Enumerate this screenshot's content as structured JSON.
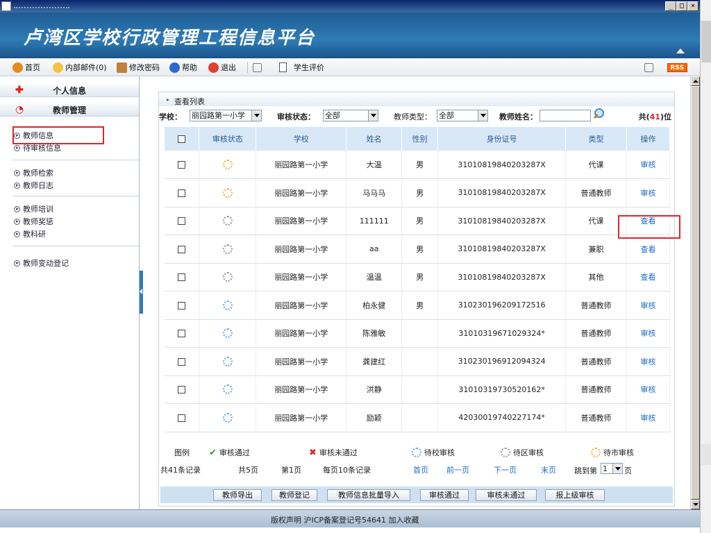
{
  "window": {
    "min_glyph": "_",
    "max_glyph": "□",
    "close_glyph": "×"
  },
  "header": {
    "title": "卢湾区学校行政管理工程信息平台"
  },
  "toolbar": {
    "home": "首页",
    "mail": "内部邮件(0)",
    "change_pwd": "修改密码",
    "help": "帮助",
    "logout": "退出",
    "student_eval": "学生评价",
    "rss": "RSS",
    "colors": {
      "home": "#e48c1e",
      "mail": "#f3c443",
      "pwd": "#c08040",
      "help": "#2a6ad0",
      "logout": "#e04030"
    }
  },
  "sidebar": {
    "sections": [
      {
        "label": "个人信息",
        "icon": "personal-icon"
      },
      {
        "label": "教师管理",
        "icon": "teacher-manage-icon"
      }
    ],
    "groups": [
      [
        "教师信息",
        "待审核信息"
      ],
      [
        "教师检索",
        "教师日志"
      ],
      [
        "教师培训",
        "教师奖惩",
        "教科研"
      ],
      [
        "教师变动登记"
      ]
    ]
  },
  "panel": {
    "header": "查看列表",
    "filters": {
      "school_label": "学校：",
      "school_value": "丽园路第一小学",
      "status_label": "审核状态：",
      "status_value": "全部",
      "type_label": "教师类型：",
      "type_value": "全部",
      "name_label": "教师姓名：",
      "name_value": "",
      "total_prefix": "共(",
      "total_count": "41",
      "total_suffix": ")位"
    },
    "columns": [
      "审核状态",
      "学校",
      "姓名",
      "性别",
      "身份证号",
      "类型",
      "操作"
    ],
    "rows": [
      {
        "status": "orange",
        "school": "丽园路第一小学",
        "name": "大温",
        "gender": "男",
        "id": "31010819840203287X",
        "type": "代课",
        "op": "审核"
      },
      {
        "status": "orange",
        "school": "丽园路第一小学",
        "name": "马马马",
        "gender": "男",
        "id": "31010819840203287X",
        "type": "普通教师",
        "op": "审核"
      },
      {
        "status": "gray",
        "school": "丽园路第一小学",
        "name": "111111",
        "gender": "男",
        "id": "31010819840203287X",
        "type": "代课",
        "op": "查看"
      },
      {
        "status": "gray",
        "school": "丽园路第一小学",
        "name": "aa",
        "gender": "男",
        "id": "31010819840203287X",
        "type": "兼职",
        "op": "查看"
      },
      {
        "status": "gray",
        "school": "丽园路第一小学",
        "name": "温温",
        "gender": "男",
        "id": "31010819840203287X",
        "type": "其他",
        "op": "查看"
      },
      {
        "status": "blue",
        "school": "丽园路第一小学",
        "name": "柏永健",
        "gender": "男",
        "id": "310230196209172516",
        "type": "普通教师",
        "op": "审核"
      },
      {
        "status": "blue",
        "school": "丽园路第一小学",
        "name": "陈雅敏",
        "gender": "",
        "id": "31010319671029324*",
        "type": "普通教师",
        "op": "审核"
      },
      {
        "status": "blue",
        "school": "丽园路第一小学",
        "name": "龚建红",
        "gender": "",
        "id": "310230196912094324",
        "type": "普通教师",
        "op": "审核"
      },
      {
        "status": "blue",
        "school": "丽园路第一小学",
        "name": "洪静",
        "gender": "",
        "id": "31010319730520162*",
        "type": "普通教师",
        "op": "审核"
      },
      {
        "status": "blue",
        "school": "丽园路第一小学",
        "name": "励颖",
        "gender": "",
        "id": "42030019740227174*",
        "type": "普通教师",
        "op": "审核"
      }
    ],
    "legend": {
      "title": "图例",
      "passed": "审核通过",
      "failed": "审核未通过",
      "pending_school": "待校审核",
      "pending_district": "待区审核",
      "pending_city": "待市审核",
      "passed_glyph": "✔",
      "failed_glyph": "✖",
      "colors": {
        "passed": "#2aa02a",
        "failed": "#e0242a"
      }
    },
    "pager": {
      "records": "共41条记录",
      "pages": "共5页",
      "current": "第1页",
      "per_page": "每页10条记录",
      "first": "首页",
      "prev": "前一页",
      "next": "下一页",
      "last": "末页",
      "jump_prefix": "跳到第",
      "jump_value": "1",
      "jump_suffix": "页"
    },
    "actions": [
      "教师导出",
      "教师登记",
      "教师信息批量导入",
      "审核通过",
      "审核未通过",
      "报上级审核"
    ]
  },
  "footer": {
    "text": "版权声明 沪ICP备案登记号54641   加入收藏"
  }
}
